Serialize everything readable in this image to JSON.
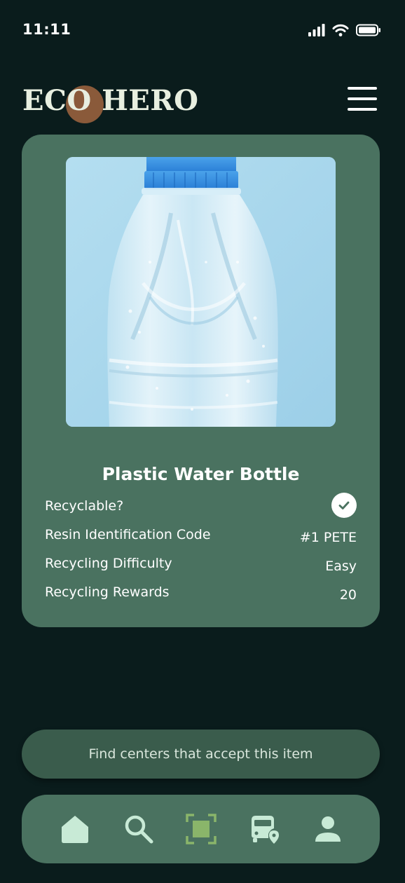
{
  "status_bar": {
    "time": "11:11",
    "icons": [
      "signal-icon",
      "wifi-icon",
      "battery-icon"
    ]
  },
  "header": {
    "logo_text": "ECO HERO",
    "menu_icon": "hamburger-menu-icon"
  },
  "item": {
    "image": "plastic-water-bottle-photo",
    "name": "Plastic Water Bottle",
    "attributes": [
      {
        "label": "Recyclable?",
        "value": "",
        "icon": "check-icon"
      },
      {
        "label": "Resin Identification Code",
        "value": "#1 PETE"
      },
      {
        "label": "Recycling Difficulty",
        "value": "Easy"
      },
      {
        "label": "Recycling Rewards",
        "value": "20"
      }
    ]
  },
  "actions": {
    "find_centers_label": "Find centers that accept this item"
  },
  "nav": {
    "items": [
      {
        "name": "home",
        "icon": "home-icon"
      },
      {
        "name": "search",
        "icon": "search-icon"
      },
      {
        "name": "scan",
        "icon": "scan-icon",
        "active": true
      },
      {
        "name": "transit",
        "icon": "bus-location-icon"
      },
      {
        "name": "profile",
        "icon": "user-icon"
      }
    ]
  },
  "colors": {
    "background": "#0a1c1c",
    "card": "#4a7260",
    "button": "#3a5c4c",
    "nav_icon": "#c8ead6",
    "scan_accent": "#8ab56a",
    "logo_accent": "#8a5a3a"
  }
}
